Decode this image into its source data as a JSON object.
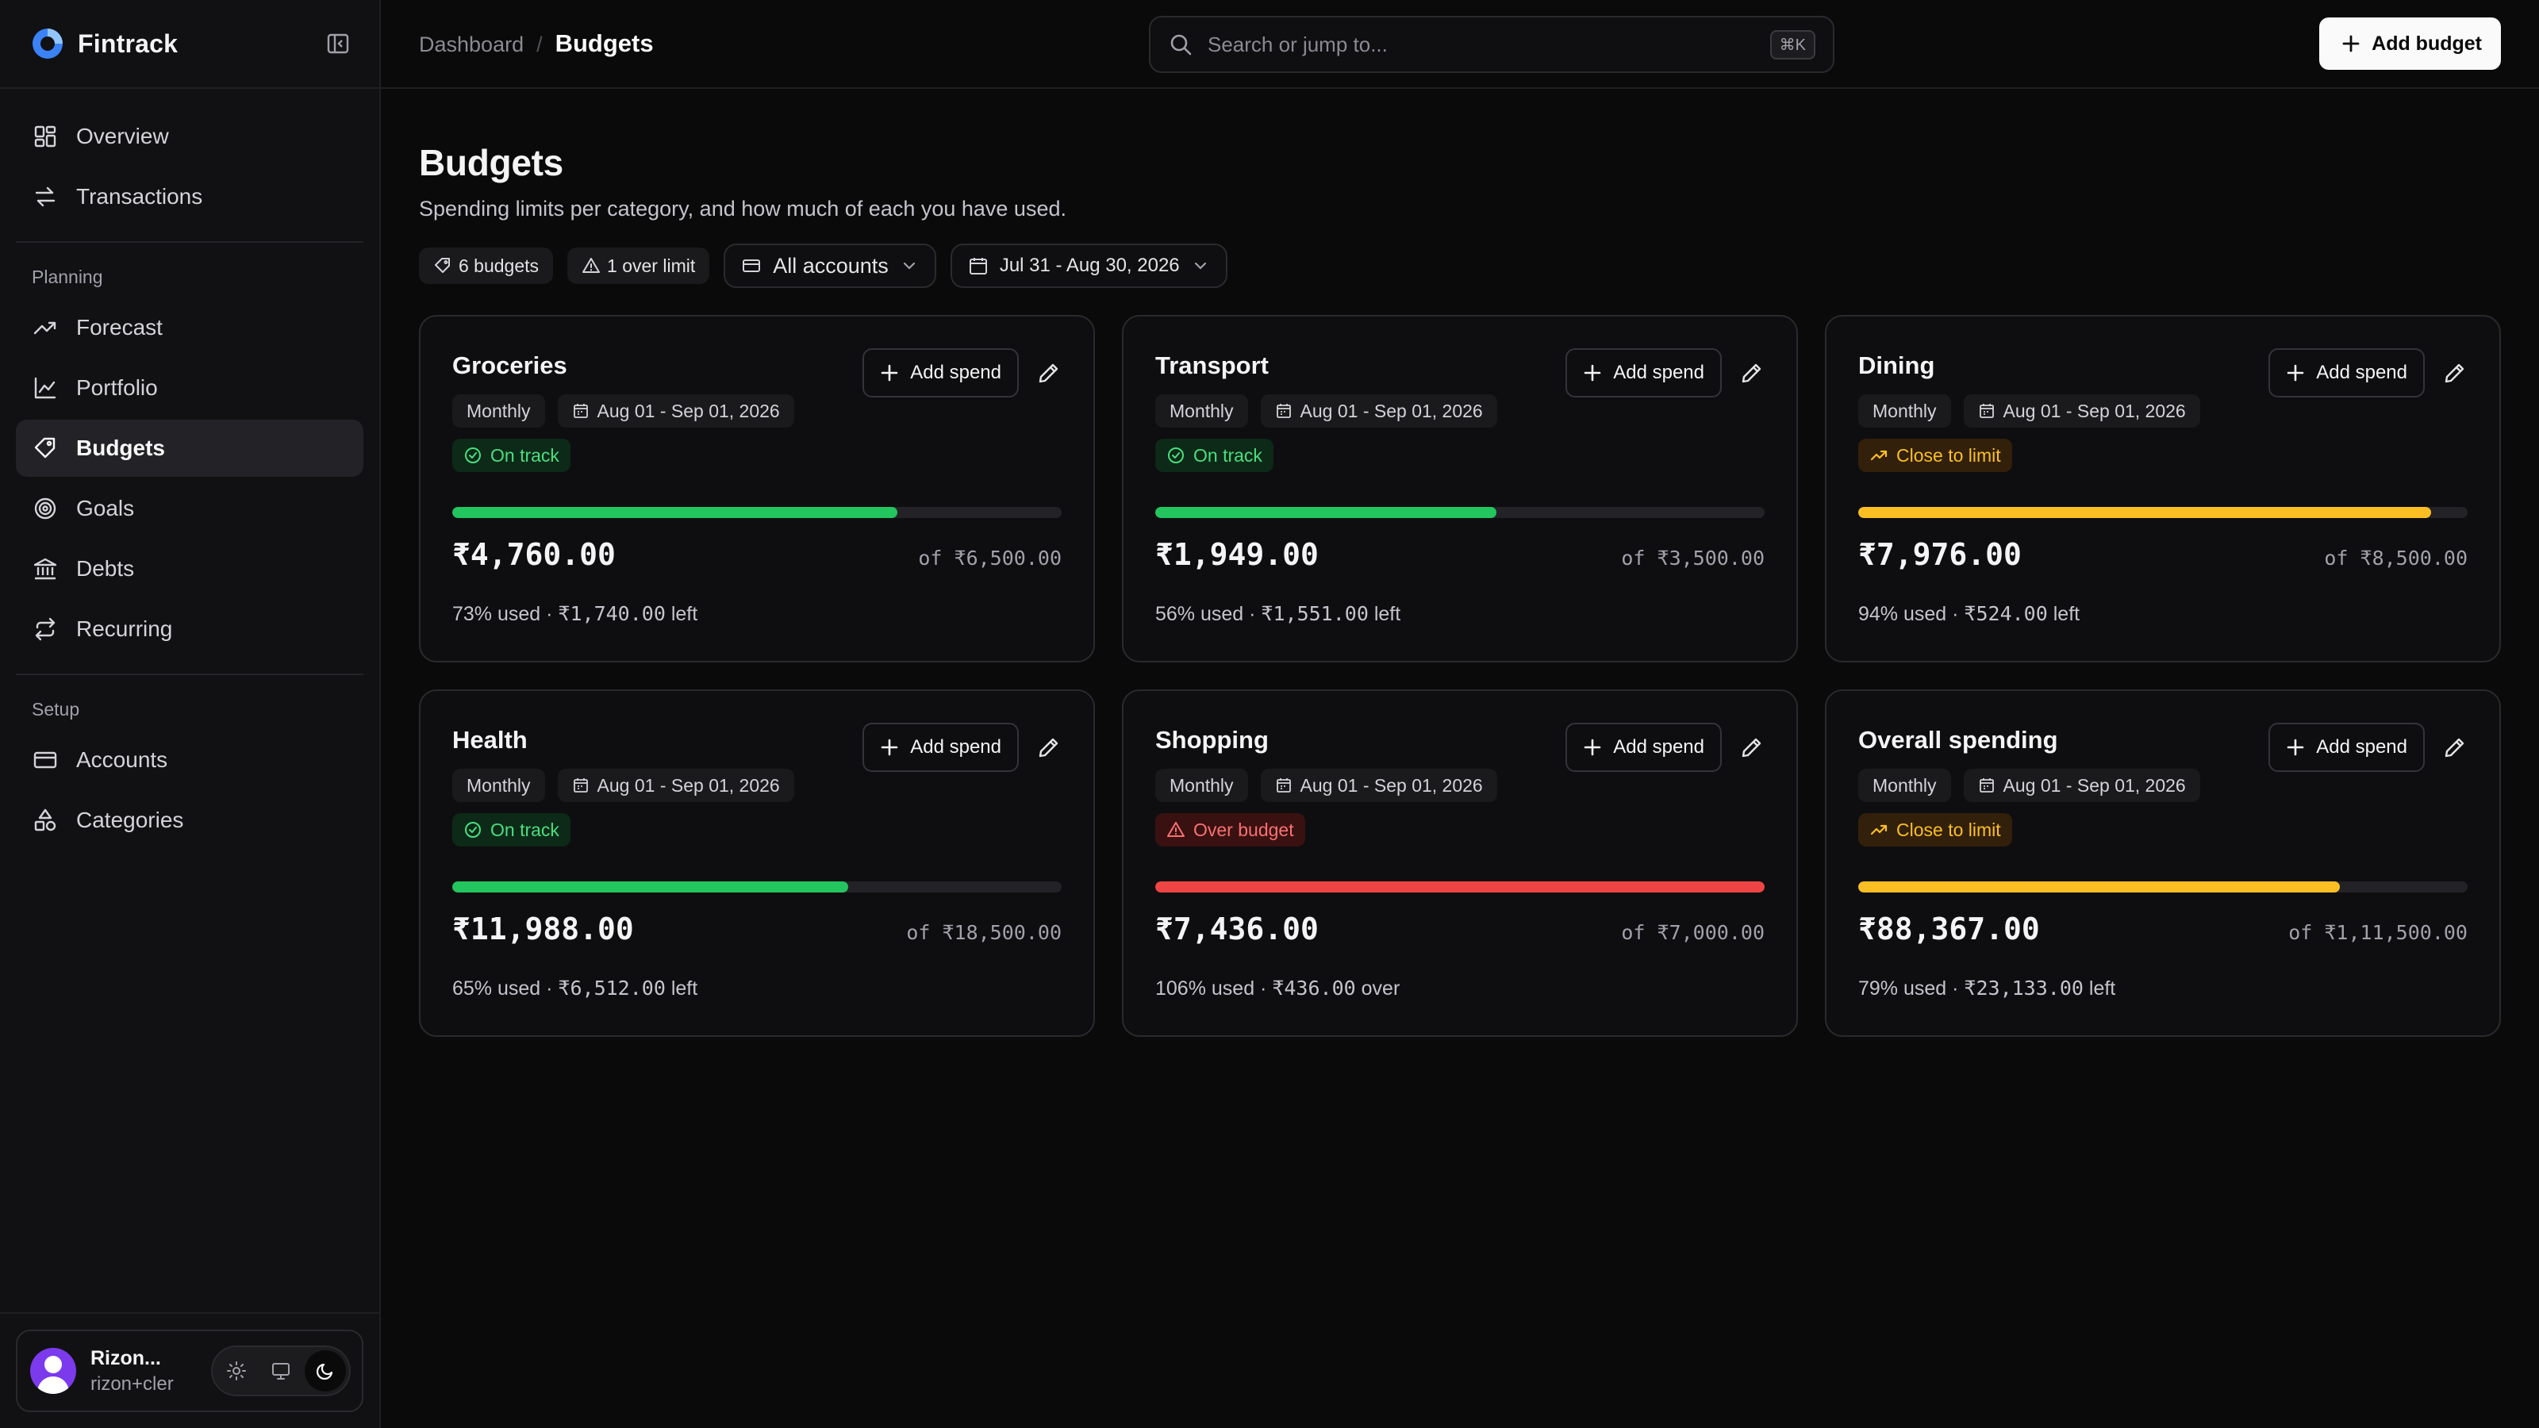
{
  "app": {
    "name": "Fintrack"
  },
  "sidebar": {
    "nav": [
      {
        "label": "Overview",
        "icon": "grid-icon"
      },
      {
        "label": "Transactions",
        "icon": "arrows-icon"
      }
    ],
    "planning_label": "Planning",
    "planning": [
      {
        "label": "Forecast",
        "icon": "trend-icon"
      },
      {
        "label": "Portfolio",
        "icon": "chart-line-icon"
      },
      {
        "label": "Budgets",
        "icon": "tag-icon",
        "active": true
      },
      {
        "label": "Goals",
        "icon": "target-icon"
      },
      {
        "label": "Debts",
        "icon": "bank-icon"
      },
      {
        "label": "Recurring",
        "icon": "repeat-icon"
      }
    ],
    "setup_label": "Setup",
    "setup": [
      {
        "label": "Accounts",
        "icon": "card-icon"
      },
      {
        "label": "Categories",
        "icon": "shapes-icon"
      }
    ],
    "user": {
      "name": "Rizon...",
      "email": "rizon+cler"
    }
  },
  "topbar": {
    "breadcrumb_parent": "Dashboard",
    "breadcrumb_current": "Budgets",
    "search_placeholder": "Search or jump to...",
    "search_shortcut": "⌘K",
    "add_budget_label": "Add budget"
  },
  "page": {
    "title": "Budgets",
    "subtitle": "Spending limits per category, and how much of each you have used.",
    "budget_count": "6 budgets",
    "over_limit": "1 over limit",
    "account_filter": "All accounts",
    "date_filter": "Jul 31 - Aug 30, 2026"
  },
  "colors": {
    "on_track": "#22c55e",
    "close": "#fbbf24",
    "over": "#ef4444"
  },
  "card_labels": {
    "add_spend": "Add spend"
  },
  "budgets": [
    {
      "name": "Groceries",
      "period": "Monthly",
      "range": "Aug 01 - Sep 01, 2026",
      "status": "On track",
      "status_type": "ok",
      "progress": 0.73,
      "amount": "₹4,760.00",
      "of": "of ₹6,500.00",
      "usage_pct": "73% used",
      "remaining": "₹1,740.00",
      "remaining_suffix": "left"
    },
    {
      "name": "Transport",
      "period": "Monthly",
      "range": "Aug 01 - Sep 01, 2026",
      "status": "On track",
      "status_type": "ok",
      "progress": 0.56,
      "amount": "₹1,949.00",
      "of": "of ₹3,500.00",
      "usage_pct": "56% used",
      "remaining": "₹1,551.00",
      "remaining_suffix": "left"
    },
    {
      "name": "Dining",
      "period": "Monthly",
      "range": "Aug 01 - Sep 01, 2026",
      "status": "Close to limit",
      "status_type": "warn",
      "progress": 0.94,
      "amount": "₹7,976.00",
      "of": "of ₹8,500.00",
      "usage_pct": "94% used",
      "remaining": "₹524.00",
      "remaining_suffix": "left"
    },
    {
      "name": "Health",
      "period": "Monthly",
      "range": "Aug 01 - Sep 01, 2026",
      "status": "On track",
      "status_type": "ok",
      "progress": 0.65,
      "amount": "₹11,988.00",
      "of": "of ₹18,500.00",
      "usage_pct": "65% used",
      "remaining": "₹6,512.00",
      "remaining_suffix": "left"
    },
    {
      "name": "Shopping",
      "period": "Monthly",
      "range": "Aug 01 - Sep 01, 2026",
      "status": "Over budget",
      "status_type": "bad",
      "progress": 1.0,
      "amount": "₹7,436.00",
      "of": "of ₹7,000.00",
      "usage_pct": "106% used",
      "remaining": "₹436.00",
      "remaining_suffix": "over"
    },
    {
      "name": "Overall spending",
      "period": "Monthly",
      "range": "Aug 01 - Sep 01, 2026",
      "status": "Close to limit",
      "status_type": "warn",
      "progress": 0.79,
      "amount": "₹88,367.00",
      "of": "of ₹1,11,500.00",
      "usage_pct": "79% used",
      "remaining": "₹23,133.00",
      "remaining_suffix": "left"
    }
  ]
}
